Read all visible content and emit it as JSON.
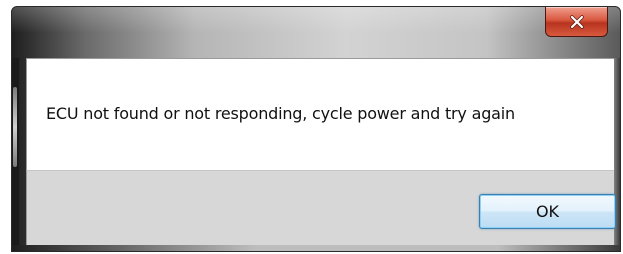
{
  "dialog": {
    "message": "ECU not found or not responding, cycle power and try again",
    "ok_label": "OK",
    "close_icon": "close-icon",
    "close_button_color": "#c8432b",
    "ok_border_color": "#3c7fb1"
  }
}
